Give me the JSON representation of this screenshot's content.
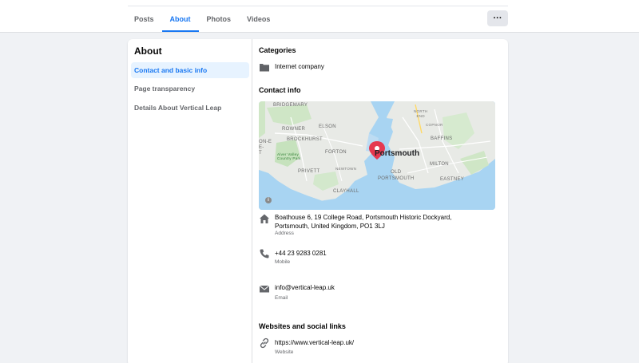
{
  "tabs": [
    {
      "label": "Posts"
    },
    {
      "label": "About"
    },
    {
      "label": "Photos"
    },
    {
      "label": "Videos"
    }
  ],
  "more_button": "···",
  "about": {
    "title": "About",
    "nav": [
      {
        "label": "Contact and basic info"
      },
      {
        "label": "Page transparency"
      },
      {
        "label": "Details About Vertical Leap"
      }
    ]
  },
  "categories": {
    "title": "Categories",
    "value": "Internet company"
  },
  "contact": {
    "title": "Contact info",
    "map_labels": {
      "bridgemary": "BRIDGEMARY",
      "rowner": "ROWNER",
      "elson": "ELSON",
      "brockhurst": "BROCKHURST",
      "forton": "FORTON",
      "privett": "PRIVETT",
      "newtown": "NEWTOWN",
      "clayhall": "CLAYHALL",
      "old_portsmouth": "OLD\nPORTSMOUTH",
      "portsmouth": "Portsmouth",
      "baffins": "BAFFINS",
      "milton": "MILTON",
      "eastney": "EASTNEY",
      "north_end": "NORTH\nEND",
      "copnor": "COPNOR",
      "park": "Alver Valley\nCountry Park",
      "edge": "ON-E\nE-\nT"
    },
    "address": "Boathouse 6, 19 College Road, Portsmouth Historic Dockyard, Portsmouth, United Kingdom, PO1 3LJ",
    "address_label": "Address",
    "phone": "+44 23 9283 0281",
    "phone_label": "Mobile",
    "email": "info@vertical-leap.uk",
    "email_label": "Email"
  },
  "websites": {
    "title": "Websites and social links",
    "url": "https://www.vertical-leap.uk/",
    "url_label": "Website"
  },
  "colors": {
    "accent": "#1877f2",
    "active_bg": "#e7f3ff",
    "pin": "#e53950"
  }
}
